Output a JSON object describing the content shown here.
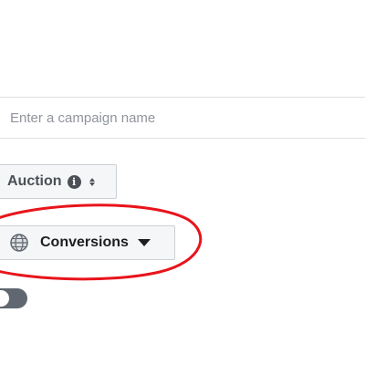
{
  "campaign_name": {
    "placeholder": "Enter a campaign name",
    "value": ""
  },
  "buying_type": {
    "label": "Auction",
    "info_icon": "info-icon",
    "arrow_icon": "up-down-arrows-icon"
  },
  "objective": {
    "label": "Conversions",
    "icon": "globe-icon",
    "arrow_icon": "caret-down-icon"
  },
  "annotation": {
    "shape": "ellipse",
    "color": "#e8141b",
    "encircles": "objective"
  },
  "toggle": {
    "state": "off"
  }
}
